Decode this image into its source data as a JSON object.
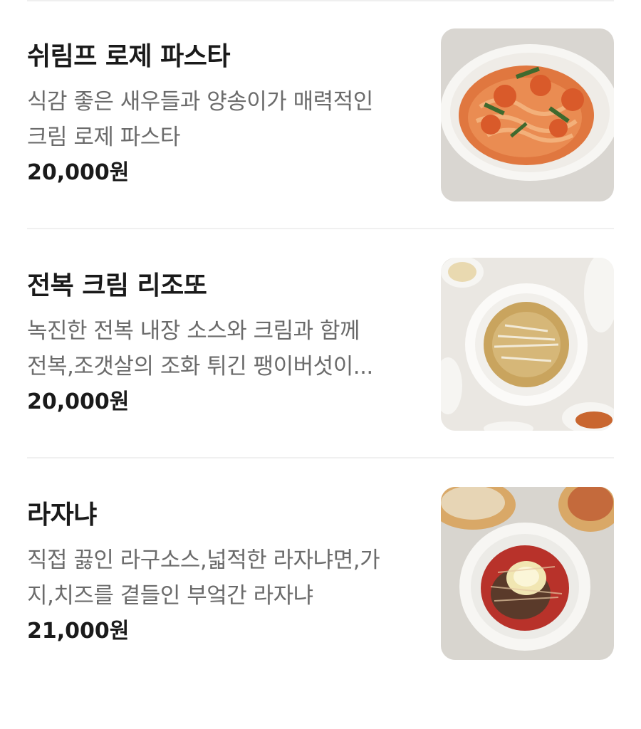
{
  "menu": {
    "items": [
      {
        "name": "쉬림프 로제 파스타",
        "description": "식감 좋은 새우들과 양송이가 매력적인\n크림 로제 파스타",
        "price": "20,000원",
        "image_icon": "shrimp-rose-pasta-photo"
      },
      {
        "name": "전복 크림 리조또",
        "description": "녹진한 전복 내장 소스와 크림과 함께\n전복,조갯살의 조화 튀긴 팽이버섯이...",
        "price": "20,000원",
        "image_icon": "abalone-cream-risotto-photo"
      },
      {
        "name": "라자냐",
        "description": "직접 끓인 라구소스,넓적한 라자냐면,가\n지,치즈를 곁들인 부엌간 라자냐",
        "price": "21,000원",
        "image_icon": "lasagna-photo"
      }
    ]
  },
  "colors": {
    "name_text": "#1a1a1a",
    "description_text": "#6b6b6b",
    "price_text": "#1a1a1a",
    "divider": "#f0f0f0"
  }
}
